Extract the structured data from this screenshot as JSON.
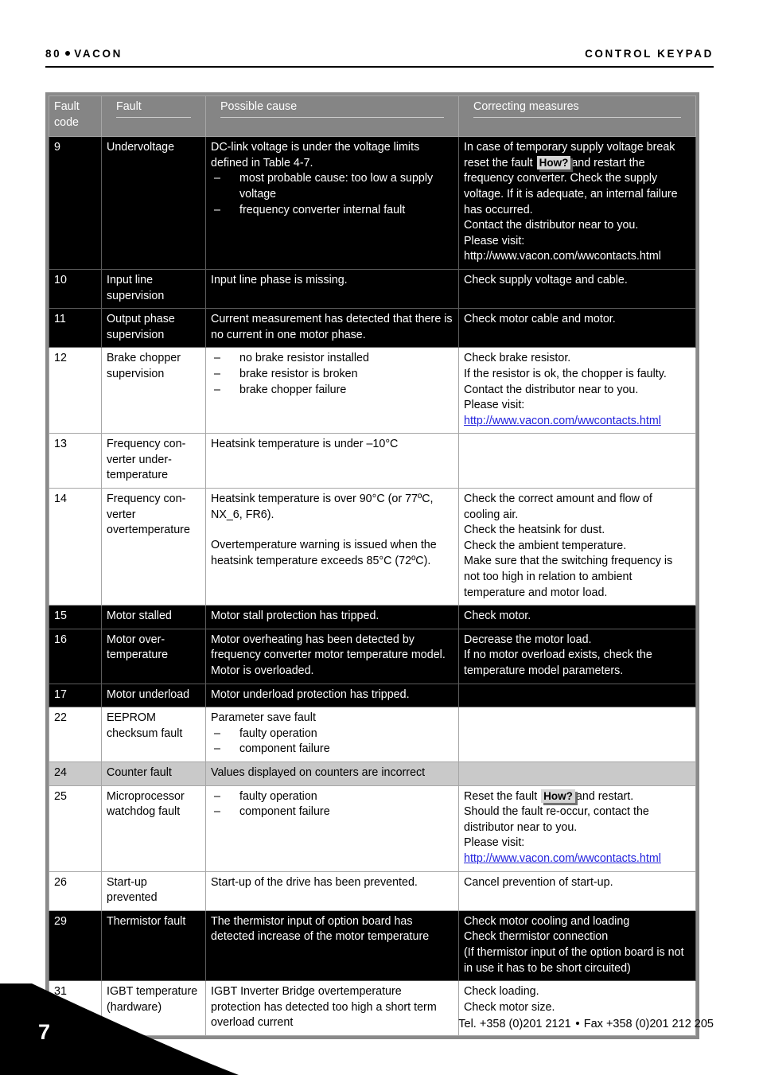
{
  "header": {
    "page_label": "80",
    "brand": "VACON",
    "section_title": "CONTROL KEYPAD"
  },
  "table": {
    "columns": [
      "Fault code",
      "Fault",
      "Possible cause",
      "Correcting measures"
    ],
    "col_code_line1": "Fault",
    "col_code_line2": "code",
    "rows": [
      {
        "theme": "dark",
        "code": "9",
        "fault": "Undervoltage",
        "cause_text": "DC-link voltage is under the voltage limits defined in Table 4-7.",
        "cause_items": [
          "most probable cause: too low a supply voltage",
          "frequency converter internal fault"
        ],
        "measure_a": "In case of temporary supply voltage break reset the fault ",
        "measure_badge": "How?",
        "measure_b": "and restart the frequency converter. Check the supply voltage. If it is adequate, an internal failure has occurred.",
        "measure_c": "Contact the distributor near to you.",
        "measure_d": "Please visit:",
        "measure_link": "http://www.vacon.com/wwcontacts.html"
      },
      {
        "theme": "dark",
        "code": "10",
        "fault": "Input line supervision",
        "cause_text": "Input line phase is missing.",
        "cause_items": [],
        "measure_a": "Check supply voltage and cable."
      },
      {
        "theme": "dark",
        "code": "11",
        "fault": "Output phase supervision",
        "cause_text": "Current measurement has detected that there is no current in one motor phase.",
        "cause_items": [],
        "measure_a": "Check motor cable and motor."
      },
      {
        "theme": "light",
        "code": "12",
        "fault": "Brake chopper supervision",
        "cause_text": "",
        "cause_items": [
          "no brake resistor  installed",
          "brake resistor is broken",
          "brake chopper failure"
        ],
        "measure_a": "Check brake resistor.",
        "measure_b": "If the resistor is ok, the chopper is faulty. Contact the distributor near to you.",
        "measure_d": "Please visit:",
        "measure_link": "http://www.vacon.com/wwcontacts.html"
      },
      {
        "theme": "light",
        "code": "13",
        "fault": "Frequency con-verter under-temperature",
        "cause_text": "Heatsink temperature is under –10°C",
        "cause_items": [],
        "measure_a": ""
      },
      {
        "theme": "light",
        "code": "14",
        "fault": "Frequency con-verter overtemperature",
        "cause_text": "Heatsink temperature is over 90°C (or 77ºC, NX_6, FR6).",
        "cause_text2": "Overtemperature warning is issued when the heatsink temperature exceeds 85°C (72ºC).",
        "cause_items": [],
        "measure_a": "Check the correct amount and flow of cooling air.",
        "measure_b": "Check the heatsink for dust.",
        "measure_c": "Check the ambient temperature.",
        "measure_d": "Make sure that the switching frequency is not too high in relation to ambient temperature and motor load."
      },
      {
        "theme": "dark",
        "code": "15",
        "fault": "Motor stalled",
        "cause_text": "Motor stall protection has tripped.",
        "cause_items": [],
        "measure_a": "Check motor."
      },
      {
        "theme": "dark",
        "code": "16",
        "fault": "Motor over-temperature",
        "cause_text": "Motor overheating has been detected by frequency converter motor temperature model. Motor is overloaded.",
        "cause_items": [],
        "measure_a": "Decrease the motor load.",
        "measure_b": "If no motor overload exists, check the temperature model parameters."
      },
      {
        "theme": "dark",
        "code": "17",
        "fault": "Motor underload",
        "cause_text": "Motor underload protection has tripped.",
        "cause_items": [],
        "measure_a": ""
      },
      {
        "theme": "light",
        "code": "22",
        "fault": "EEPROM checksum fault",
        "cause_text": "Parameter save fault",
        "cause_items": [
          "faulty operation",
          "component failure"
        ],
        "measure_a": ""
      },
      {
        "theme": "gray",
        "code": "24",
        "fault": "Counter fault",
        "cause_text": "Values displayed on counters are incorrect",
        "cause_items": [],
        "measure_a": ""
      },
      {
        "theme": "light",
        "code": "25",
        "fault": "Microprocessor watchdog fault",
        "cause_text": "",
        "cause_items": [
          "faulty operation",
          "component failure"
        ],
        "measure_a": "Reset the fault ",
        "measure_badge": "How?",
        "measure_b": "and restart.",
        "measure_c": "Should the fault re-occur, contact the distributor near to you.",
        "measure_d": "Please visit:",
        "measure_link": "http://www.vacon.com/wwcontacts.html"
      },
      {
        "theme": "light",
        "code": "26",
        "fault": "Start-up prevented",
        "cause_text": "Start-up of the drive has been prevented.",
        "cause_items": [],
        "measure_a": "Cancel prevention of start-up."
      },
      {
        "theme": "dark",
        "code": "29",
        "fault": "Thermistor fault",
        "cause_text": "The thermistor input of option board has detected increase of the motor temperature",
        "cause_items": [],
        "measure_a": "Check motor cooling and loading",
        "measure_b": "Check thermistor connection",
        "measure_c": "(If thermistor input of the option board is not in use it has to be short circuited)"
      },
      {
        "theme": "light",
        "code": "31",
        "fault": "IGBT temperature (hardware)",
        "cause_text": "IGBT Inverter Bridge overtemperature protection has detected too high a short term overload current",
        "cause_items": [],
        "measure_a": "Check loading.",
        "measure_b": "Check motor size."
      }
    ]
  },
  "footer": {
    "page_number": "7",
    "contact_tel": "Tel. +358 (0)201 2121",
    "contact_fax": "Fax +358 (0)201 212 205"
  },
  "colors": {
    "header_gray": "#858585",
    "frame_gray": "#8a8a8a",
    "row_gray": "#c9c9c9",
    "link_blue": "#2222dd"
  }
}
